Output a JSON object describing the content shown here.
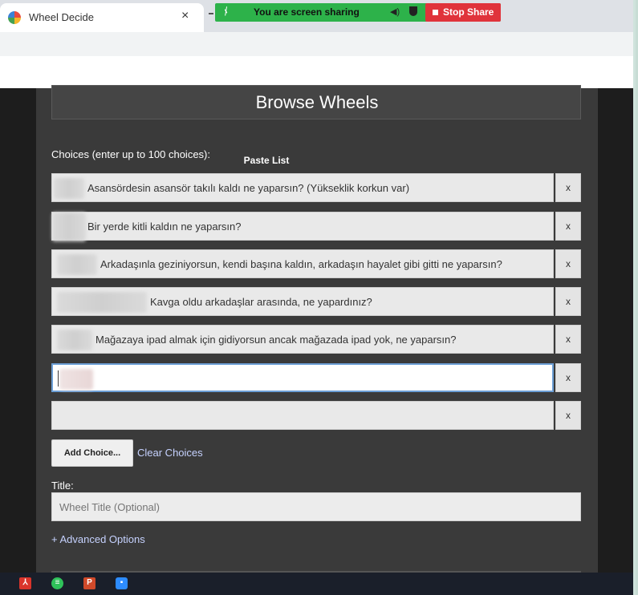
{
  "browser": {
    "tab_title": "Wheel Decide",
    "tab_close": "×"
  },
  "share_banner": {
    "text": "You are screen sharing",
    "stop_label": "Stop Share"
  },
  "page": {
    "heading": "Browse Wheels",
    "choices_label": "Choices (enter up to 100 choices):",
    "paste_label": "Paste List",
    "choices": [
      "Asansördesin asansör takılı kaldı ne yaparsın? (Yükseklik korkun var)",
      "Bir yerde kitli kaldın ne yaparsın?",
      "Arkadaşınla geziniyorsun, kendi başına kaldın, arkadaşın hayalet gibi gitti ne yaparsın?",
      "Kavga oldu arkadaşlar arasında, ne yapardınız?",
      "Mağazaya ipad almak için gidiyorsun ancak mağazada ipad yok, ne yaparsın?",
      "",
      ""
    ],
    "remove_label": "x",
    "add_choice_label": "Add Choice...",
    "clear_choices_label": "Clear Choices",
    "title_label": "Title:",
    "title_placeholder": "Wheel Title (Optional)",
    "advanced_label": "+ Advanced Options"
  },
  "taskbar": {
    "icons": [
      "acrobat-icon",
      "spotify-icon",
      "powerpoint-icon",
      "zoom-icon"
    ]
  },
  "colors": {
    "share_green": "#2db24a",
    "stop_red": "#e0333b",
    "link": "#c6d2ff",
    "panel": "#3a3a3a"
  }
}
